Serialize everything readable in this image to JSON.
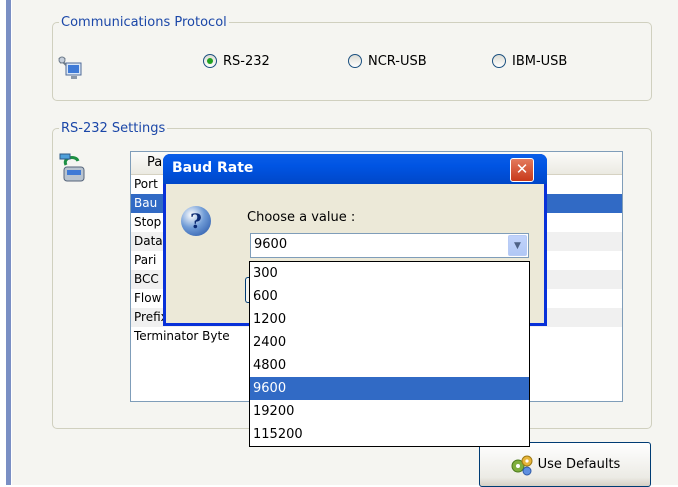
{
  "protocol_group": {
    "legend": "Communications Protocol",
    "options": [
      {
        "label": "RS-232",
        "selected": true
      },
      {
        "label": "NCR-USB",
        "selected": false
      },
      {
        "label": "IBM-USB",
        "selected": false
      }
    ],
    "icon": "network-computer-icon"
  },
  "rs232_group": {
    "legend": "RS-232 Settings",
    "icon": "serial-cable-icon",
    "grid": {
      "header_first": "Pa",
      "rows": [
        {
          "label": "Port",
          "selected": false
        },
        {
          "label": "Bau",
          "selected": true
        },
        {
          "label": "Stop",
          "selected": false
        },
        {
          "label": "Data",
          "selected": false
        },
        {
          "label": "Pari",
          "selected": false
        },
        {
          "label": "BCC",
          "selected": false
        },
        {
          "label": "Flow Control",
          "selected": false
        },
        {
          "label": "Prefix Byte",
          "selected": false
        },
        {
          "label": "Terminator Byte",
          "selected": false
        }
      ]
    }
  },
  "use_defaults_button": {
    "label": "Use Defaults",
    "icon": "gears-icon"
  },
  "dialog": {
    "title": "Baud Rate",
    "close_glyph": "✕",
    "question_glyph": "?",
    "prompt": "Choose a value :",
    "combo_value": "9600",
    "options": [
      "300",
      "600",
      "1200",
      "2400",
      "4800",
      "9600",
      "19200",
      "115200"
    ],
    "selected_option": "9600"
  },
  "colors": {
    "accent": "#316ac5",
    "legend_text": "#1b47a8",
    "title_bar": "#0054e3"
  }
}
